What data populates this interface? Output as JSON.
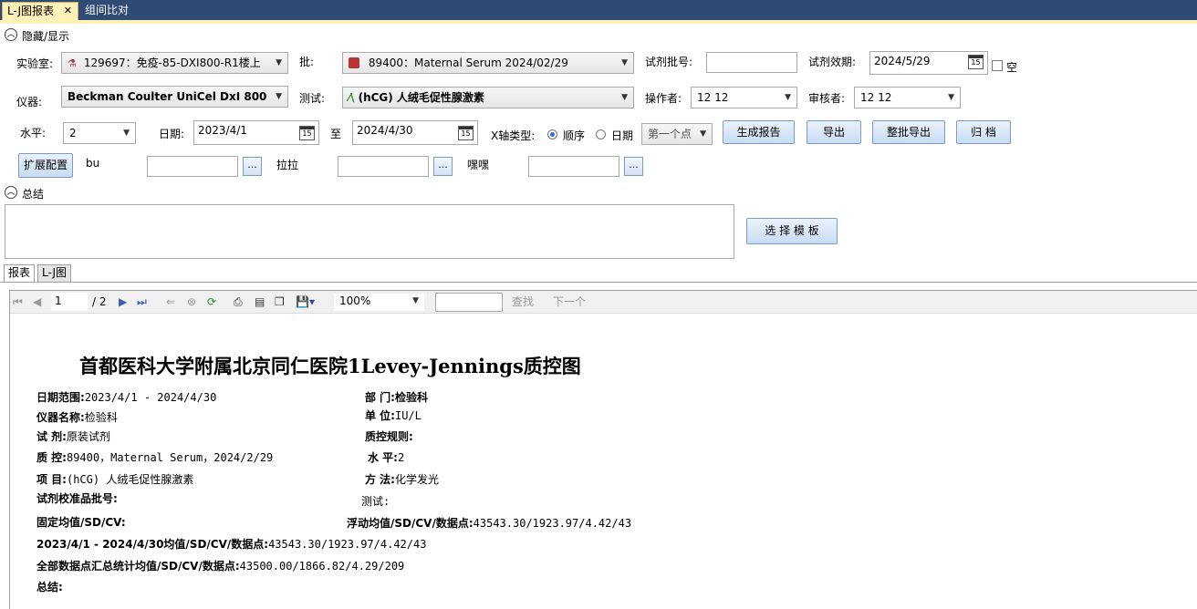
{
  "tabs": {
    "active": "L-J图报表",
    "close": "✕",
    "inactive": "组间比对"
  },
  "sections": {
    "toggle": "隐藏/显示",
    "summary": "总结"
  },
  "filters": {
    "lab_label": "实验室:",
    "lab_value": "129697：免疫-85-DXI800-R1楼上",
    "batch_label": "批:",
    "batch_value": "89400：Maternal Serum 2024/02/29",
    "lot_label": "试剂批号:",
    "lot_value": "",
    "expiry_label": "试剂效期:",
    "expiry_value": "2024/5/29",
    "empty_label": "空",
    "instrument_label": "仪器:",
    "instrument_value": "Beckman Coulter UniCel DxI 800",
    "test_label": "测试:",
    "test_value": "(hCG) 人绒毛促性腺激素",
    "operator_label": "操作者:",
    "operator_value": "12 12",
    "reviewer_label": "审核者:",
    "reviewer_value": "12 12",
    "level_label": "水平:",
    "level_value": "2",
    "date_label": "日期:",
    "date_from": "2023/4/1",
    "to_label": "至",
    "date_to": "2024/4/30",
    "xaxis_label": "X轴类型:",
    "radio_seq": "顺序",
    "radio_date": "日期",
    "point_value": "第一个点",
    "calendar_day": "15"
  },
  "buttons": {
    "generate": "生成报告",
    "export": "导出",
    "batch_export": "整批导出",
    "archive": "归 档",
    "ext_config": "扩展配置",
    "template": "选 择 模 板",
    "dots": "..."
  },
  "ext": {
    "f1_label": "bu",
    "f2_label": "拉拉",
    "f3_label": "嘿嘿"
  },
  "subtabs": {
    "report": "报表",
    "lj": "L-J图"
  },
  "viewer": {
    "page": "1",
    "total": "/ 2",
    "zoom": "100%",
    "find": "查找",
    "next": "下一个"
  },
  "report": {
    "title": "首都医科大学附属北京同仁医院1Levey-Jennings质控图",
    "date_range_k": "日期范围:",
    "date_range_v": "2023/4/1 - 2024/4/30",
    "dept_k": "部    门:",
    "dept_v": "检验科",
    "inst_k": "仪器名称:",
    "inst_v": "检验科",
    "unit_k": "单    位:",
    "unit_v": "IU/L",
    "reagent_k": "试    剂:",
    "reagent_v": "原装试剂",
    "rule_k": "质控规则:",
    "qc_k": "质    控:",
    "qc_v": "89400，Maternal Serum，2024/2/29",
    "level_k": "水    平:",
    "level_v": "2",
    "item_k": "项    目:",
    "item_v": "(hCG) 人绒毛促性腺激素",
    "method_k": "方    法:",
    "method_v": "化学发光",
    "calib_k": "试剂校准品批号:",
    "test_k": "测试:",
    "fixed_k": "固定均值/SD/CV:",
    "float_k": "浮动均值/SD/CV/数据点:",
    "float_v": "43543.30/1923.97/4.42/43",
    "range_k": "2023/4/1 - 2024/4/30均值/SD/CV/数据点:",
    "range_v": "43543.30/1923.97/4.42/43",
    "all_k": "全部数据点汇总统计均值/SD/CV/数据点:",
    "all_v": "43500.00/1866.82/4.29/209",
    "summary_k": "总结:"
  },
  "colors": {
    "titlebar": "#2f4a73",
    "active_tab": "#fff2b8",
    "button": "#c9dcf3"
  }
}
